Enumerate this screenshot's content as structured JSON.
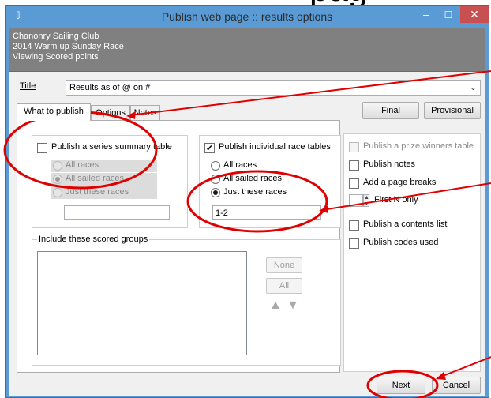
{
  "background": {
    "heading_fragment": "pag",
    "faded_text": "~~~~~~~~~~~~~~~~"
  },
  "window": {
    "title": "Publish web page :: results options",
    "minimize_glyph": "–",
    "maximize_glyph": "☐",
    "close_glyph": "✕",
    "accent": "#5b9bd5",
    "close_color": "#c75050"
  },
  "header": {
    "club": "Chanonry Sailing Club",
    "race": "2014 Warm up Sunday Race",
    "viewing": "Viewing Scored points"
  },
  "title_row": {
    "label": "Title",
    "value": "Results as of @ on #",
    "dropdown_glyph": "⌄"
  },
  "buttons": {
    "final": "Final",
    "provisional": "Provisional",
    "none": "None",
    "all": "All",
    "next": "Next",
    "cancel": "Cancel"
  },
  "tabs": [
    {
      "label": "What to publish",
      "active": true
    },
    {
      "label": "Options",
      "active": false
    },
    {
      "label": "Notes",
      "active": false
    }
  ],
  "series_summary": {
    "label": "Publish a series summary table",
    "checked": false,
    "options": [
      "All races",
      "All sailed races",
      "Just these races"
    ],
    "selected_index": 1,
    "races_value": ""
  },
  "individual_tables": {
    "label": "Publish individual race tables",
    "checked": true,
    "options": [
      "All races",
      "All sailed races",
      "Just these races"
    ],
    "selected_index": 2,
    "races_value": "1-2"
  },
  "right_options": {
    "prize_winners": {
      "label": "Publish a prize winners table",
      "checked": false,
      "enabled": false
    },
    "notes": {
      "label": "Publish notes",
      "checked": false
    },
    "page_breaks": {
      "label": "Add a page breaks",
      "checked": false
    },
    "first_n": {
      "label": "First N only",
      "value": ""
    },
    "contents_list": {
      "label": "Publish a contents list",
      "checked": false
    },
    "codes_used": {
      "label": "Publish codes used",
      "checked": false
    }
  },
  "scored_groups": {
    "label": "Include these scored groups",
    "up_icon": "▲",
    "down_icon": "▼"
  },
  "annotation_color": "#e00000"
}
